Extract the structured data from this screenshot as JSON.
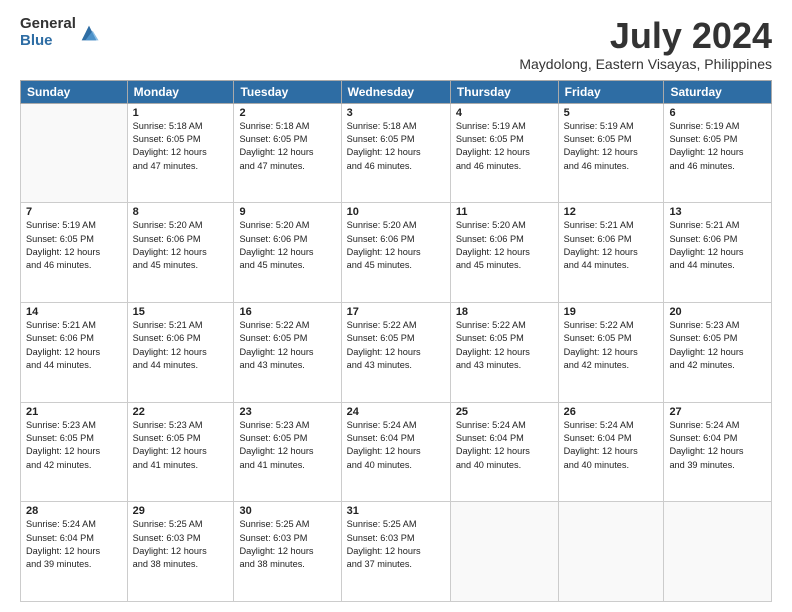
{
  "header": {
    "logo_general": "General",
    "logo_blue": "Blue",
    "title": "July 2024",
    "subtitle": "Maydolong, Eastern Visayas, Philippines"
  },
  "days_of_week": [
    "Sunday",
    "Monday",
    "Tuesday",
    "Wednesday",
    "Thursday",
    "Friday",
    "Saturday"
  ],
  "weeks": [
    [
      {
        "num": "",
        "info": ""
      },
      {
        "num": "1",
        "info": "Sunrise: 5:18 AM\nSunset: 6:05 PM\nDaylight: 12 hours\nand 47 minutes."
      },
      {
        "num": "2",
        "info": "Sunrise: 5:18 AM\nSunset: 6:05 PM\nDaylight: 12 hours\nand 47 minutes."
      },
      {
        "num": "3",
        "info": "Sunrise: 5:18 AM\nSunset: 6:05 PM\nDaylight: 12 hours\nand 46 minutes."
      },
      {
        "num": "4",
        "info": "Sunrise: 5:19 AM\nSunset: 6:05 PM\nDaylight: 12 hours\nand 46 minutes."
      },
      {
        "num": "5",
        "info": "Sunrise: 5:19 AM\nSunset: 6:05 PM\nDaylight: 12 hours\nand 46 minutes."
      },
      {
        "num": "6",
        "info": "Sunrise: 5:19 AM\nSunset: 6:05 PM\nDaylight: 12 hours\nand 46 minutes."
      }
    ],
    [
      {
        "num": "7",
        "info": "Sunrise: 5:19 AM\nSunset: 6:05 PM\nDaylight: 12 hours\nand 46 minutes."
      },
      {
        "num": "8",
        "info": "Sunrise: 5:20 AM\nSunset: 6:06 PM\nDaylight: 12 hours\nand 45 minutes."
      },
      {
        "num": "9",
        "info": "Sunrise: 5:20 AM\nSunset: 6:06 PM\nDaylight: 12 hours\nand 45 minutes."
      },
      {
        "num": "10",
        "info": "Sunrise: 5:20 AM\nSunset: 6:06 PM\nDaylight: 12 hours\nand 45 minutes."
      },
      {
        "num": "11",
        "info": "Sunrise: 5:20 AM\nSunset: 6:06 PM\nDaylight: 12 hours\nand 45 minutes."
      },
      {
        "num": "12",
        "info": "Sunrise: 5:21 AM\nSunset: 6:06 PM\nDaylight: 12 hours\nand 44 minutes."
      },
      {
        "num": "13",
        "info": "Sunrise: 5:21 AM\nSunset: 6:06 PM\nDaylight: 12 hours\nand 44 minutes."
      }
    ],
    [
      {
        "num": "14",
        "info": "Sunrise: 5:21 AM\nSunset: 6:06 PM\nDaylight: 12 hours\nand 44 minutes."
      },
      {
        "num": "15",
        "info": "Sunrise: 5:21 AM\nSunset: 6:06 PM\nDaylight: 12 hours\nand 44 minutes."
      },
      {
        "num": "16",
        "info": "Sunrise: 5:22 AM\nSunset: 6:05 PM\nDaylight: 12 hours\nand 43 minutes."
      },
      {
        "num": "17",
        "info": "Sunrise: 5:22 AM\nSunset: 6:05 PM\nDaylight: 12 hours\nand 43 minutes."
      },
      {
        "num": "18",
        "info": "Sunrise: 5:22 AM\nSunset: 6:05 PM\nDaylight: 12 hours\nand 43 minutes."
      },
      {
        "num": "19",
        "info": "Sunrise: 5:22 AM\nSunset: 6:05 PM\nDaylight: 12 hours\nand 42 minutes."
      },
      {
        "num": "20",
        "info": "Sunrise: 5:23 AM\nSunset: 6:05 PM\nDaylight: 12 hours\nand 42 minutes."
      }
    ],
    [
      {
        "num": "21",
        "info": "Sunrise: 5:23 AM\nSunset: 6:05 PM\nDaylight: 12 hours\nand 42 minutes."
      },
      {
        "num": "22",
        "info": "Sunrise: 5:23 AM\nSunset: 6:05 PM\nDaylight: 12 hours\nand 41 minutes."
      },
      {
        "num": "23",
        "info": "Sunrise: 5:23 AM\nSunset: 6:05 PM\nDaylight: 12 hours\nand 41 minutes."
      },
      {
        "num": "24",
        "info": "Sunrise: 5:24 AM\nSunset: 6:04 PM\nDaylight: 12 hours\nand 40 minutes."
      },
      {
        "num": "25",
        "info": "Sunrise: 5:24 AM\nSunset: 6:04 PM\nDaylight: 12 hours\nand 40 minutes."
      },
      {
        "num": "26",
        "info": "Sunrise: 5:24 AM\nSunset: 6:04 PM\nDaylight: 12 hours\nand 40 minutes."
      },
      {
        "num": "27",
        "info": "Sunrise: 5:24 AM\nSunset: 6:04 PM\nDaylight: 12 hours\nand 39 minutes."
      }
    ],
    [
      {
        "num": "28",
        "info": "Sunrise: 5:24 AM\nSunset: 6:04 PM\nDaylight: 12 hours\nand 39 minutes."
      },
      {
        "num": "29",
        "info": "Sunrise: 5:25 AM\nSunset: 6:03 PM\nDaylight: 12 hours\nand 38 minutes."
      },
      {
        "num": "30",
        "info": "Sunrise: 5:25 AM\nSunset: 6:03 PM\nDaylight: 12 hours\nand 38 minutes."
      },
      {
        "num": "31",
        "info": "Sunrise: 5:25 AM\nSunset: 6:03 PM\nDaylight: 12 hours\nand 37 minutes."
      },
      {
        "num": "",
        "info": ""
      },
      {
        "num": "",
        "info": ""
      },
      {
        "num": "",
        "info": ""
      }
    ]
  ]
}
